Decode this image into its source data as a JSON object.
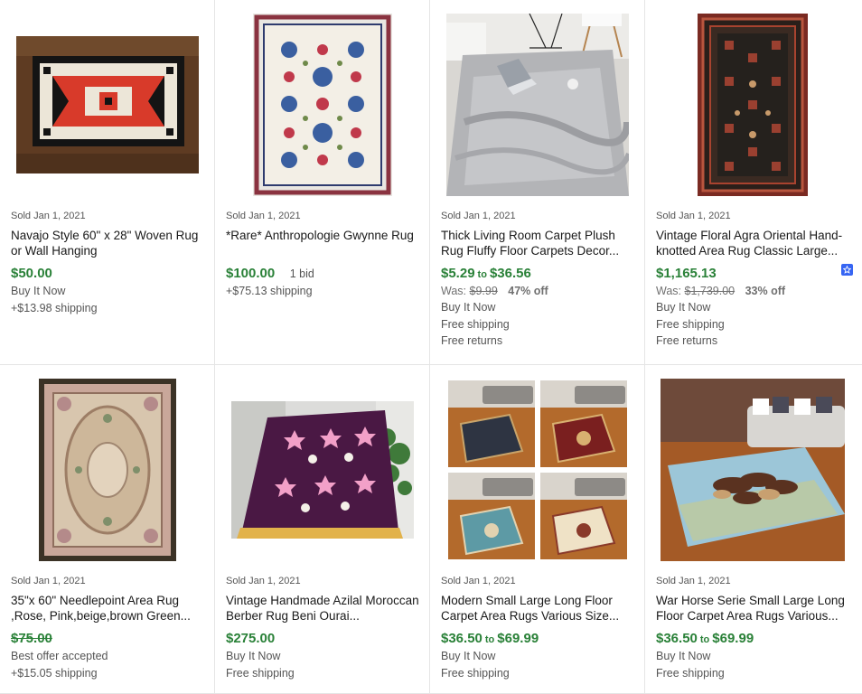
{
  "listings": [
    {
      "sold": "Sold Jan 1, 2021",
      "title": "Navajo Style 60\" x 28\" Woven Rug or Wall Hanging",
      "price": "$50.00",
      "lines": [
        "Buy It Now",
        "+$13.98 shipping"
      ],
      "image": "navajo-rug"
    },
    {
      "sold": "Sold Jan 1, 2021",
      "title": "*Rare* Anthropologie Gwynne Rug",
      "price": "$100.00",
      "bids": "1 bid",
      "lines": [
        "+$75.13 shipping"
      ],
      "image": "anthropologie-rug"
    },
    {
      "sold": "Sold Jan 1, 2021",
      "title": "Thick Living Room Carpet Plush Rug Fluffy Floor Carpets Decor...",
      "price_from": "$5.29",
      "price_to": "$36.56",
      "to_label": "to",
      "was_label": "Was:",
      "was": "$9.99",
      "off": "47% off",
      "lines": [
        "Buy It Now",
        "Free shipping",
        "Free returns"
      ],
      "image": "fluffy-gray-rug"
    },
    {
      "sold": "Sold Jan 1, 2021",
      "title": "Vintage Floral Agra Oriental Hand-knotted Area Rug Classic Large...",
      "price": "$1,165.13",
      "was_label": "Was:",
      "was": "$1,739.00",
      "off": "33% off",
      "lines": [
        "Buy It Now",
        "Free shipping",
        "Free returns"
      ],
      "badge": "top-rated-seller-icon",
      "image": "agra-oriental-rug"
    },
    {
      "sold": "Sold Jan 1, 2021",
      "title": "35\"x 60\" Needlepoint Area Rug ,Rose, Pink,beige,brown Green...",
      "price": "$75.00",
      "strike": true,
      "lines": [
        "Best offer accepted",
        "+$15.05 shipping"
      ],
      "image": "needlepoint-rug"
    },
    {
      "sold": "Sold Jan 1, 2021",
      "title": "Vintage Handmade Azilal Moroccan Berber Rug Beni Ourai...",
      "price": "$275.00",
      "lines": [
        "Buy It Now",
        "Free shipping"
      ],
      "image": "azilal-rug"
    },
    {
      "sold": "Sold Jan 1, 2021",
      "title": "Modern Small Large Long Floor Carpet Area Rugs Various Size...",
      "price_from": "$36.50",
      "price_to": "$69.99",
      "to_label": "to",
      "lines": [
        "Buy It Now",
        "Free shipping"
      ],
      "image": "four-room-rugs"
    },
    {
      "sold": "Sold Jan 1, 2021",
      "title": "War Horse Serie Small Large Long Floor Carpet Area Rugs Various...",
      "price_from": "$36.50",
      "price_to": "$69.99",
      "to_label": "to",
      "lines": [
        "Buy It Now",
        "Free shipping"
      ],
      "image": "war-horse-rug"
    }
  ],
  "colors": {
    "price_green": "#2a8138",
    "badge_blue": "#3665f3",
    "divider": "#e5e5e5"
  }
}
